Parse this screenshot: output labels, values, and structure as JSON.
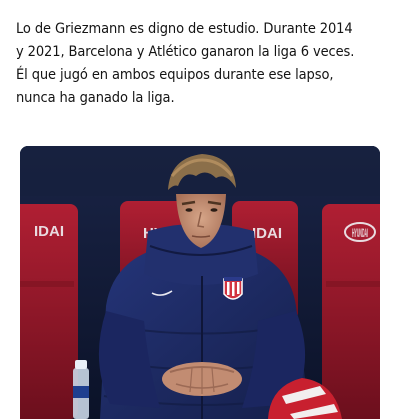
{
  "post": {
    "caption_lines": [
      "Lo de Griezmann es digno de estudio. Durante 2014",
      "y 2021, Barcelona y Atlético ganaron la liga 6 veces.",
      "Él que jugó en ambos equipos durante ese lapso,",
      "nunca ha ganado la liga."
    ]
  },
  "photo": {
    "seat_text_left": "IDAI",
    "seat_text_center_left": "HY",
    "seat_text_center_right": "IDAI",
    "seat_text_right": "HYUNDAI",
    "colors": {
      "background": "#0f1730",
      "seat_red": "#a3182b",
      "jacket_navy": "#1d2a63",
      "skin": "#c99478"
    }
  }
}
